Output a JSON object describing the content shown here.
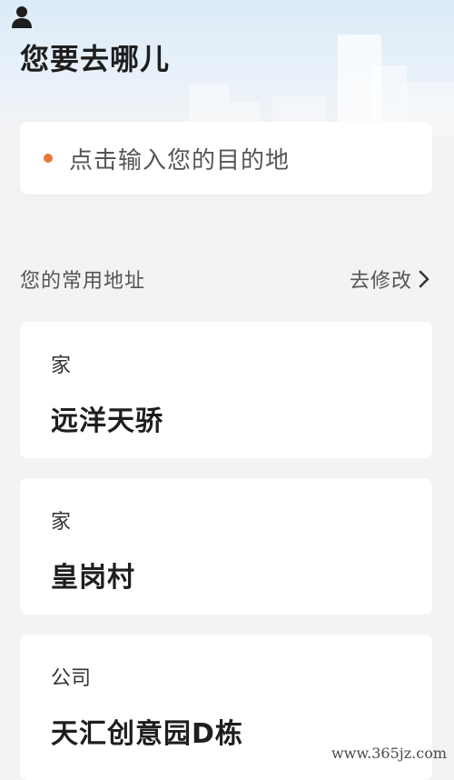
{
  "header": {
    "title": "您要去哪儿"
  },
  "search": {
    "placeholder": "点击输入您的目的地",
    "dot_color": "#e8773a"
  },
  "section": {
    "title": "您的常用地址",
    "edit_label": "去修改"
  },
  "addresses": [
    {
      "type": "家",
      "name": "远洋天骄"
    },
    {
      "type": "家",
      "name": "皇岗村"
    },
    {
      "type": "公司",
      "name": "天汇创意园D栋"
    }
  ],
  "watermark": "www.365jz.com"
}
